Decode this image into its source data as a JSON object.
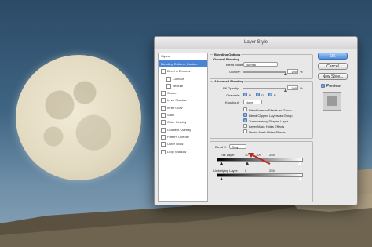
{
  "dialog": {
    "title": "Layer Style",
    "styles_header": "Styles",
    "styles_items": [
      {
        "label": "Blending Options: Custom",
        "selected": true,
        "checkbox": false,
        "indent": false
      },
      {
        "label": "Bevel & Emboss",
        "selected": false,
        "checkbox": true,
        "indent": false
      },
      {
        "label": "Contour",
        "selected": false,
        "checkbox": true,
        "indent": true
      },
      {
        "label": "Texture",
        "selected": false,
        "checkbox": true,
        "indent": true
      },
      {
        "label": "Stroke",
        "selected": false,
        "checkbox": true,
        "indent": false
      },
      {
        "label": "Inner Shadow",
        "selected": false,
        "checkbox": true,
        "indent": false
      },
      {
        "label": "Inner Glow",
        "selected": false,
        "checkbox": true,
        "indent": false
      },
      {
        "label": "Satin",
        "selected": false,
        "checkbox": true,
        "indent": false
      },
      {
        "label": "Color Overlay",
        "selected": false,
        "checkbox": true,
        "indent": false
      },
      {
        "label": "Gradient Overlay",
        "selected": false,
        "checkbox": true,
        "indent": false
      },
      {
        "label": "Pattern Overlay",
        "selected": false,
        "checkbox": true,
        "indent": false
      },
      {
        "label": "Outer Glow",
        "selected": false,
        "checkbox": true,
        "indent": false
      },
      {
        "label": "Drop Shadow",
        "selected": false,
        "checkbox": true,
        "indent": false
      }
    ],
    "blending_options": {
      "section_title": "Blending Options",
      "general_title": "General Blending",
      "blend_mode_label": "Blend Mode:",
      "blend_mode_value": "Normal",
      "opacity_label": "Opacity:",
      "opacity_value": "100",
      "opacity_unit": "%"
    },
    "advanced": {
      "title": "Advanced Blending",
      "fill_opacity_label": "Fill Opacity:",
      "fill_opacity_value": "100",
      "fill_opacity_unit": "%",
      "channels_label": "Channels:",
      "channel_r": "R",
      "channel_g": "G",
      "channel_b": "B",
      "knockout_label": "Knockout:",
      "knockout_value": "None",
      "options": [
        {
          "label": "Blend Interior Effects as Group",
          "checked": false
        },
        {
          "label": "Blend Clipped Layers as Group",
          "checked": true
        },
        {
          "label": "Transparency Shapes Layer",
          "checked": true
        },
        {
          "label": "Layer Mask Hides Effects",
          "checked": false
        },
        {
          "label": "Vector Mask Hides Effects",
          "checked": false
        }
      ]
    },
    "blend_if": {
      "label": "Blend If:",
      "value": "Gray",
      "this_layer_label": "This Layer:",
      "this_layer_values": [
        "30",
        "/",
        "109",
        "255"
      ],
      "underlying_label": "Underlying Layer:",
      "underlying_values": [
        "0",
        "255"
      ]
    },
    "buttons": {
      "ok": "OK",
      "cancel": "Cancel",
      "new_style": "New Style...",
      "preview": "Preview"
    },
    "colors": {
      "selection": "#4a84d6",
      "ok_button": "#4f8fe0",
      "arrow": "#c0231e"
    }
  }
}
